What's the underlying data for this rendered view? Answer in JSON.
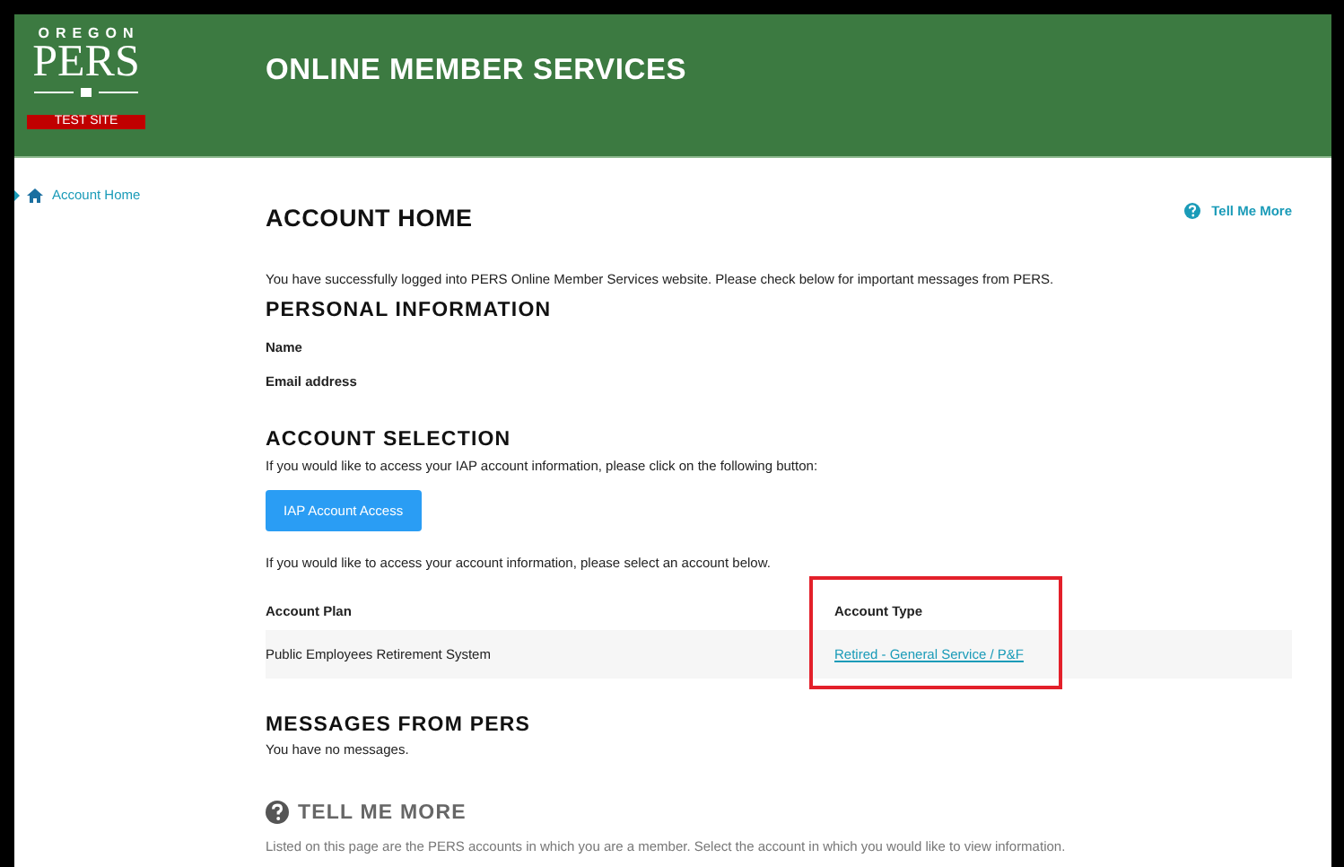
{
  "header": {
    "logo": {
      "top": "OREGON",
      "name": "PERS",
      "badge": "TEST SITE"
    },
    "title": "ONLINE MEMBER SERVICES"
  },
  "sidebar": {
    "items": [
      {
        "label": "Account Home",
        "selected": true
      }
    ]
  },
  "help_link": "Tell Me More",
  "page_title": "ACCOUNT HOME",
  "intro": "You have successfully logged into PERS Online Member Services website. Please check below for important messages from PERS.",
  "personal_information": {
    "heading": "PERSONAL INFORMATION",
    "fields": [
      "Name",
      "Email address"
    ]
  },
  "account_selection": {
    "heading": "ACCOUNT SELECTION",
    "iap_text": "If you would like to access your IAP account information, please click on the following button:",
    "iap_button": "IAP Account Access",
    "account_text": "If you would like to access your account information, please select an account below.",
    "table": {
      "columns": [
        "Account Plan",
        "Account Type"
      ],
      "rows": [
        {
          "plan": "Public Employees Retirement System",
          "type": "Retired - General Service / P&F",
          "highlighted": true
        }
      ]
    }
  },
  "messages": {
    "heading": "MESSAGES FROM PERS",
    "text": "You have no messages."
  },
  "tell_me_more": {
    "heading": "TELL ME MORE",
    "text": "Listed on this page are the PERS accounts in which you are a member. Select the account in which you would like to view information."
  }
}
